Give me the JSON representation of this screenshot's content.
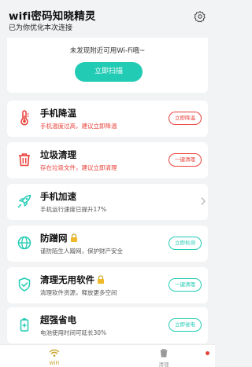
{
  "header": {
    "title": "wifi密码知晓精灵",
    "subtitle": "已为你优化本次连接",
    "settings_icon": "gear-icon"
  },
  "scan": {
    "message": "未发现附近可用Wi-Fi哦~",
    "button_label": "立即扫描"
  },
  "features": [
    {
      "title": "手机降温",
      "desc": "手机温度过高，建议立即降温",
      "action": "立即降温",
      "icon": "thermometer-icon",
      "color": "#e8413a"
    },
    {
      "title": "垃圾清理",
      "desc": "存在垃圾文件，建议立即清理",
      "action": "一键清理",
      "icon": "trash-icon",
      "color": "#e8413a"
    },
    {
      "title": "手机加速",
      "desc": "手机运行速度已提升17%",
      "icon": "rocket-icon",
      "color": "#22cbb4"
    },
    {
      "title": "防蹭网",
      "desc": "谨防陌生人蹭网，保护财产安全",
      "action": "立即检测",
      "icon": "globe-icon",
      "color": "#22cbb4",
      "locked": true
    },
    {
      "title": "清理无用软件",
      "desc": "清理软件资源，释放更多空间",
      "action": "一键清理",
      "icon": "shield-check-icon",
      "color": "#22cbb4",
      "locked": true
    },
    {
      "title": "超强省电",
      "desc": "电池使用时间可延长30%",
      "action": "立即省电",
      "icon": "battery-icon",
      "color": "#22cbb4"
    }
  ],
  "nav": {
    "wifi_label": "WiFi",
    "clean_label": "清理",
    "active_color": "#c9a227"
  }
}
